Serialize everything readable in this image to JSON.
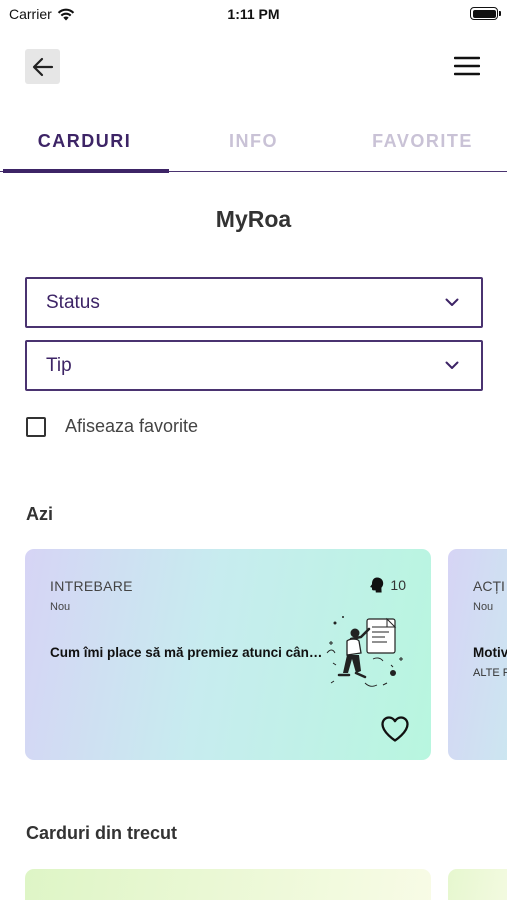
{
  "status_bar": {
    "carrier": "Carrier",
    "time": "1:11 PM"
  },
  "nav": {
    "back_icon": "arrow-left-icon",
    "menu_icon": "hamburger-icon"
  },
  "tabs": [
    {
      "label": "CARDURI",
      "active": true
    },
    {
      "label": "INFO",
      "active": false
    },
    {
      "label": "FAVORITE",
      "active": false
    }
  ],
  "page": {
    "title": "MyRoa"
  },
  "filters": {
    "status": {
      "value": "Status"
    },
    "tip": {
      "value": "Tip"
    },
    "favorites": {
      "label": "Afiseaza favorite",
      "checked": false
    }
  },
  "sections": {
    "today": "Azi",
    "past": "Carduri din trecut"
  },
  "cards_today": [
    {
      "category": "INTREBARE",
      "status": "Nou",
      "question": "Cum îmi place să mă premiez atunci când...",
      "count": "10",
      "favorite": false
    },
    {
      "category": "ACȚI",
      "status": "Nou",
      "question": "Motiv",
      "sub": "ALTE F"
    }
  ],
  "colors": {
    "accent": "#3d2466",
    "tab_inactive": "#c9c2d6"
  }
}
